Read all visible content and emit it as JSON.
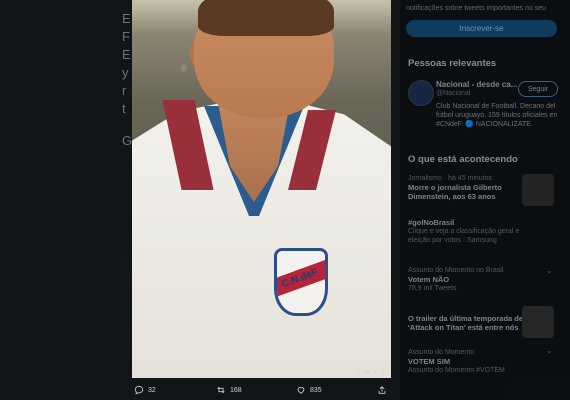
{
  "background_page": {
    "left_column_partial_lines": [
      "E",
      "F",
      "E",
      "y",
      "r",
      "t",
      "G"
    ],
    "right_sidebar": {
      "notification_text": "notificações sobre tweets importantes no seu",
      "signup_button": "Inscrever-se",
      "relevant_people": {
        "title": "Pessoas relevantes",
        "account_name": "Nacional - desde ca...",
        "handle": "@Nacional",
        "follow_button": "Seguir",
        "bio": "Club Nacional de Football. Decano del fútbol uruguayo. 159 títulos oficiales en #CNdeF. 🔵 NACIONALIZATE."
      },
      "trends": {
        "title": "O que está acontecendo",
        "items": [
          {
            "context": "Jornalismo · há 45 minutos",
            "main": "Morre o jornalista Gilberto Dimenstein, aos 63 anos"
          },
          {
            "context": "",
            "main": "#golNoBrasil",
            "sub": "Clique e veja a classificação geral e eleição por votos · Samsung"
          },
          {
            "context": "Assunto do Momento no Brasil",
            "main": "Votem NÃO",
            "sub": "78,9 mil Tweets"
          },
          {
            "context": "",
            "main": "O trailer da última temporada de 'Attack on Titan' está entre nós"
          },
          {
            "context": "Assunto do Momento",
            "main": "VOTEM SIM",
            "sub": "Assunto do Momento #VOTEM"
          }
        ]
      }
    }
  },
  "media_viewer": {
    "jersey_badge_text": "C.N.deF",
    "watermark": "C H Y F",
    "actions": {
      "reply_count": "32",
      "retweet_count": "168",
      "like_count": "835"
    }
  }
}
